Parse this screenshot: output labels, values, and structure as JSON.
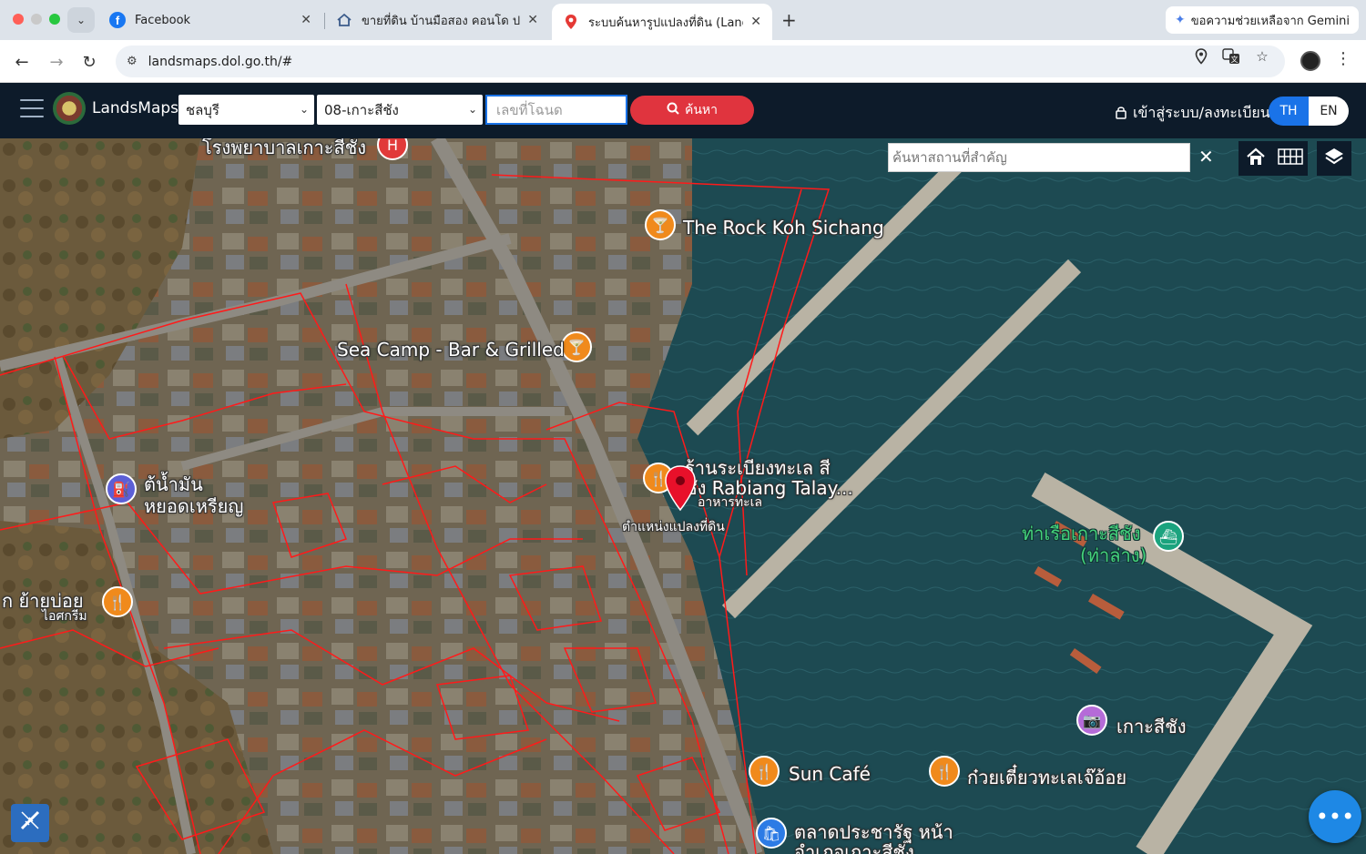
{
  "browser": {
    "tabs": [
      {
        "title": "Facebook",
        "active": false
      },
      {
        "title": "ขายที่ดิน บ้านมือสอง คอนโด ประกาศ",
        "active": false
      },
      {
        "title": "ระบบค้นหารูปแปลงที่ดิน (LandsMaps)",
        "active": true
      }
    ],
    "new_tab": "+",
    "gemini_label": "ขอความช่วยเหลือจาก Gemini",
    "url": "landsmaps.dol.go.th/#"
  },
  "app": {
    "brand": "LandsMaps",
    "province": "ชลบุรี",
    "district": "08-เกาะสีชัง",
    "deed_placeholder": "เลขที่โฉนด",
    "search_label": "ค้นหา",
    "login_label": "เข้าสู่ระบบ/ลงทะเบียน",
    "lang_th": "TH",
    "lang_en": "EN",
    "active_lang": "TH"
  },
  "map": {
    "place_search_placeholder": "ค้นหาสถานที่สำคัญ",
    "labels": {
      "hospital": "โรงพยาบาลเกาะสีชัง",
      "rock": "The Rock Koh Sichang",
      "seacamp": "Sea Camp - Bar & Grilled",
      "rabiang_th": "ร้านระเบียงทะเล สี",
      "rabiang_en": "ชัง Rabiang Talay...",
      "rabiang_sub": "อาหารทะเล",
      "parcel_marker": "ตำแหน่งแปลงที่ดิน",
      "pier": "ท่าเรือเกาะสีชัง",
      "pier_sub": "(ท่าล่าง)",
      "fuel": "ต้น้ำมัน",
      "fuel_sub": "หยอดเหรียญ",
      "icecream": "ก ย้ายบ่อย",
      "icecream_sub": "ไอศกรีม",
      "island": "เกาะสีชัง",
      "suncafe": "Sun Café",
      "noodle": "ก๋วยเตี๋ยวทะเลเจ๊อ้อย",
      "market": "ตลาดประชารัฐ หน้า",
      "market_sub": "อำเภอเกาะสีชัง"
    },
    "icons": {
      "home": "home-icon",
      "grid": "grid-icon",
      "layers": "layers-icon",
      "measure": "measure-tool-icon",
      "more": "more-icon"
    },
    "colors": {
      "parcel_lines": "#ff1a1a",
      "sea": "#1d4a52",
      "header": "#0d1b2a",
      "search_button": "#e0343e",
      "accent": "#1a73e8"
    }
  }
}
